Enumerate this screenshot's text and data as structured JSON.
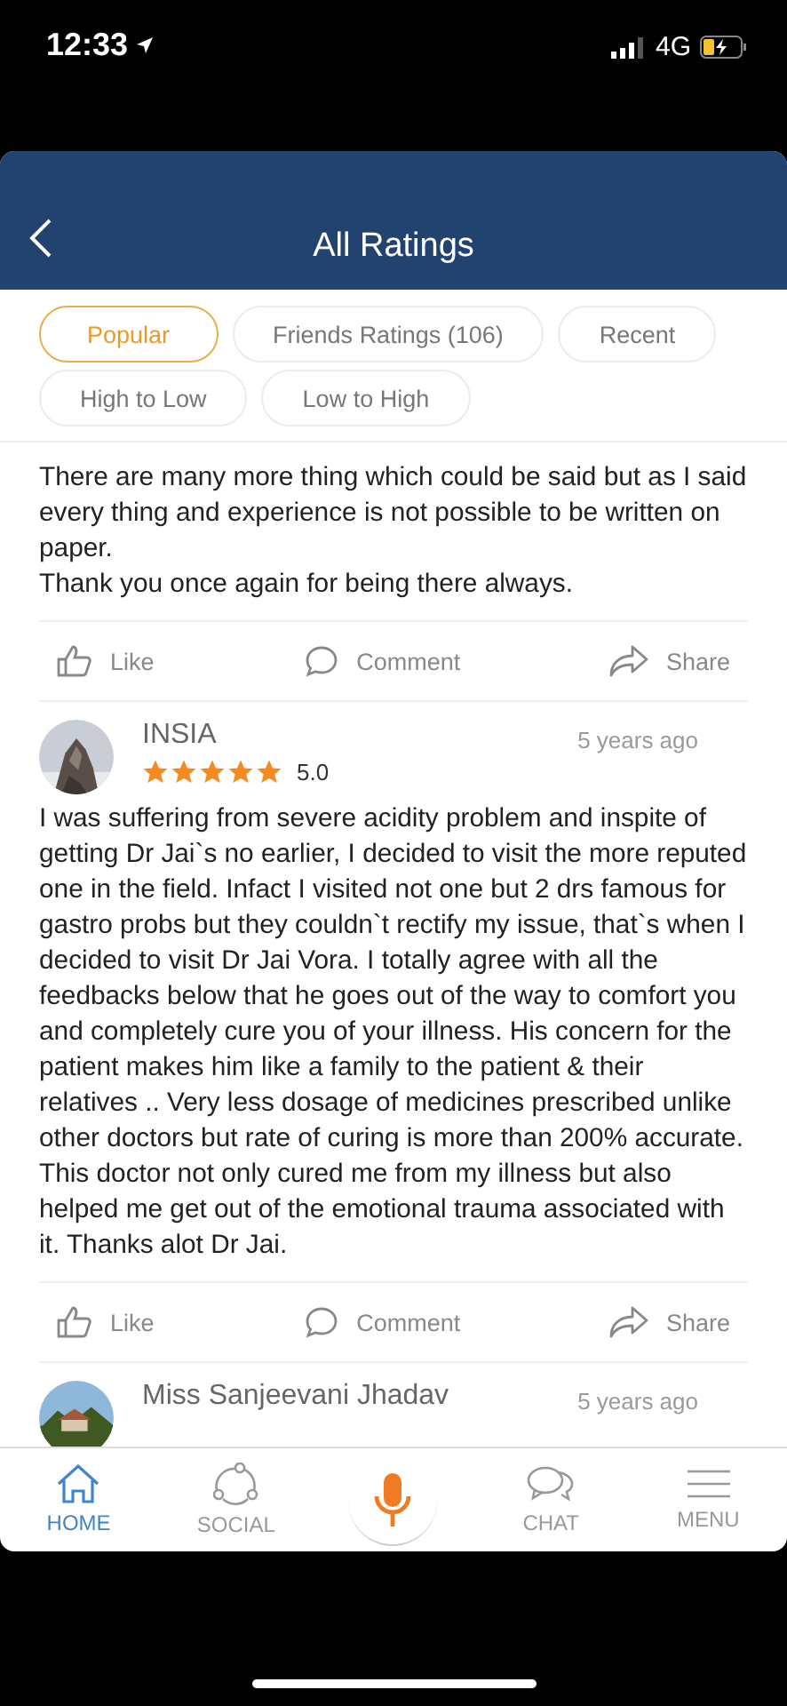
{
  "status_bar": {
    "time": "12:33",
    "network": "4G"
  },
  "header": {
    "title": "All Ratings"
  },
  "filters": [
    {
      "label": "Popular",
      "selected": true
    },
    {
      "label": "Friends Ratings (106)",
      "selected": false
    },
    {
      "label": "Recent",
      "selected": false
    },
    {
      "label": "High to Low",
      "selected": false
    },
    {
      "label": "Low to High",
      "selected": false
    }
  ],
  "reviews": [
    {
      "paragraphs": [
        "There are many more thing which could be said but as I said every thing and experience is not possible to be written on paper.",
        "Thank you once again for being there always."
      ],
      "actions": [
        "Like",
        "Comment",
        "Share"
      ]
    },
    {
      "name": "INSIA",
      "time": "5 years ago",
      "stars": 5,
      "rating": "5.0",
      "paragraphs": [
        "I was suffering from severe acidity problem and inspite of getting Dr Jai`s no earlier, I decided to visit the more reputed one in the field. Infact I visited not one but 2 drs famous for gastro probs but they couldn`t rectify my issue, that`s when I decided to visit Dr Jai Vora. I totally agree with all the feedbacks below that he goes out of the way to comfort you and completely cure you of your illness. His concern for the patient makes him like a family to the patient & their relatives .. Very less dosage of medicines prescribed unlike other doctors but rate of curing is more than 200% accurate. This doctor not only cured me from my illness but also helped me get out of the emotional trauma associated with it. Thanks alot Dr Jai."
      ],
      "actions": [
        "Like",
        "Comment",
        "Share"
      ]
    },
    {
      "name": "Miss Sanjeevani Jhadav",
      "time": "5 years ago"
    }
  ],
  "nav": [
    {
      "label": "HOME",
      "kind": "home",
      "selected": true
    },
    {
      "label": "SOCIAL",
      "kind": "social",
      "selected": false
    },
    {
      "kind": "mic"
    },
    {
      "label": "CHAT",
      "kind": "chat",
      "selected": false
    },
    {
      "label": "MENU",
      "kind": "menu",
      "selected": false
    }
  ]
}
